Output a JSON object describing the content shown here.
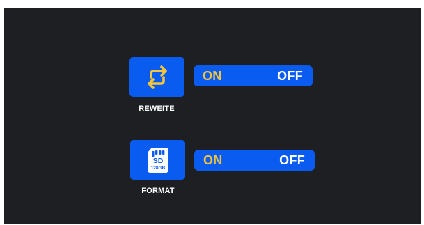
{
  "colors": {
    "background": "#1e1f23",
    "accent": "#0a5cf0",
    "active_option": "#f2c53d",
    "inactive_option": "#ffffff"
  },
  "settings": [
    {
      "icon": "loop-arrows-icon",
      "label": "REWEITE",
      "on_label": "ON",
      "off_label": "OFF",
      "selected": "ON"
    },
    {
      "icon": "sd-card-icon",
      "label": "FORMAT",
      "on_label": "ON",
      "off_label": "OFF",
      "selected": "ON",
      "icon_text": [
        "SD",
        "128GB"
      ]
    }
  ]
}
